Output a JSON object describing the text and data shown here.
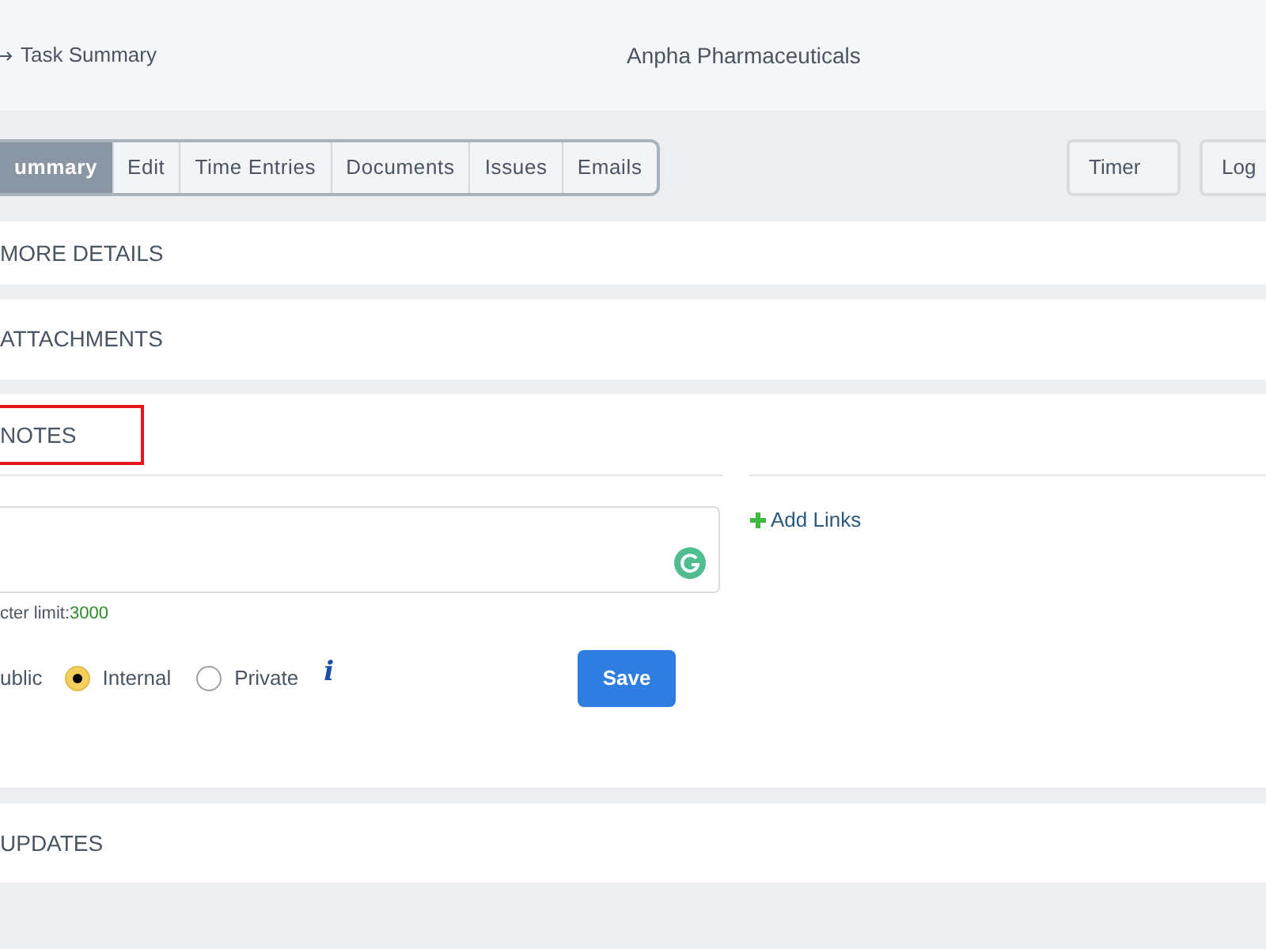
{
  "header": {
    "back_link": "Task Summary",
    "title": "Anpha Pharmaceuticals"
  },
  "tabs": [
    {
      "label": "ummary",
      "selected": true
    },
    {
      "label": "Edit",
      "selected": false
    },
    {
      "label": "Time Entries",
      "selected": false
    },
    {
      "label": "Documents",
      "selected": false
    },
    {
      "label": "Issues",
      "selected": false
    },
    {
      "label": "Emails",
      "selected": false
    }
  ],
  "actions": [
    "Timer",
    "Log"
  ],
  "sections": [
    {
      "title": "MORE DETAILS"
    },
    {
      "title": "ATTACHMENTS"
    }
  ],
  "notes": {
    "title": "NOTES",
    "highlighted": true,
    "add_links": "Add Links",
    "limit_label": "cter limit:",
    "limit_value": "3000",
    "cut_option_label": "ublic",
    "options": [
      {
        "label": "Internal",
        "selected": true
      },
      {
        "label": "Private",
        "selected": false
      }
    ],
    "info_glyph": "i",
    "save": "Save"
  },
  "updates": {
    "title": "UPDATES"
  }
}
